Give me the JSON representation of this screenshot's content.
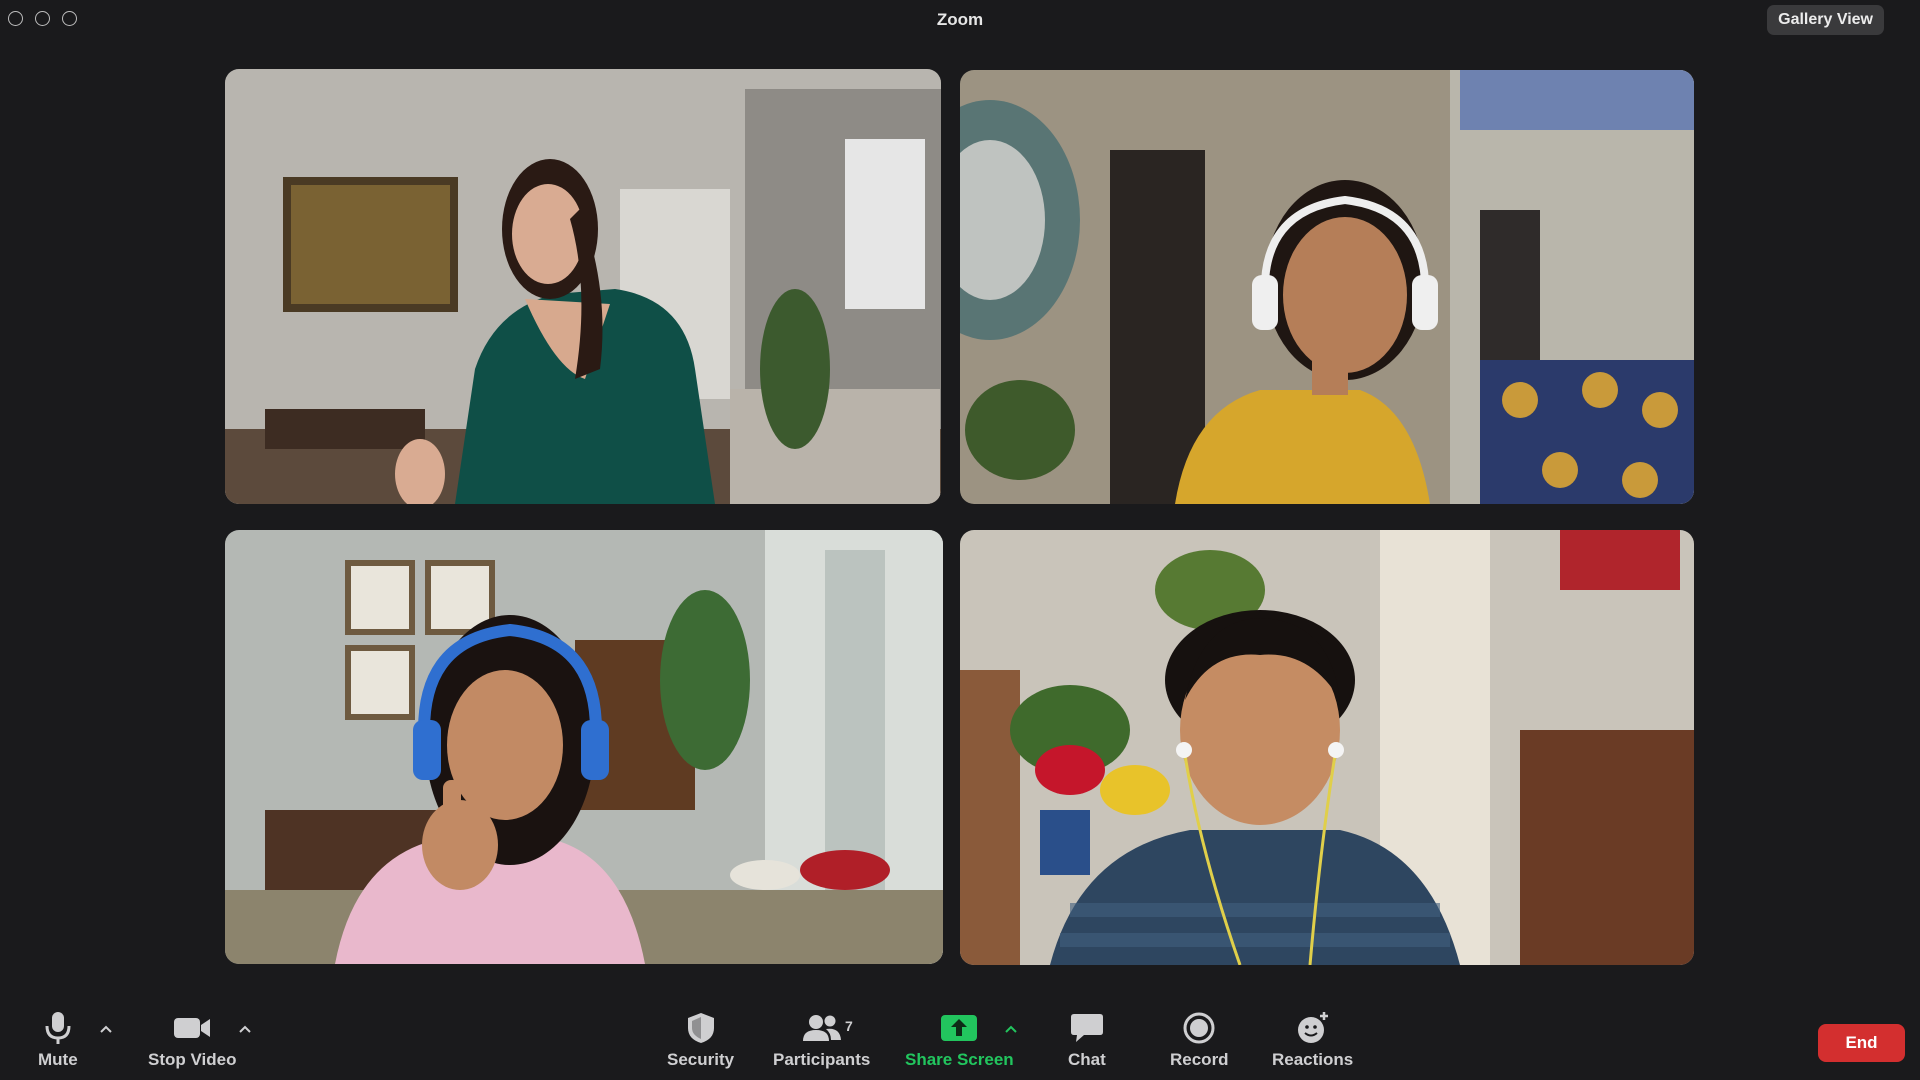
{
  "window": {
    "title": "Zoom"
  },
  "view_toggle": {
    "label": "Gallery View"
  },
  "participants_tiles": [
    {
      "scene": "woman in green top gesturing in living room",
      "accent": "#0f4f47"
    },
    {
      "scene": "girl with white headphones in yellow top",
      "accent": "#d6a62c"
    },
    {
      "scene": "girl with blue headphones giving thumbs up",
      "accent": "#e9b8cc"
    },
    {
      "scene": "boy with earphones in blue hoodie smiling",
      "accent": "#2e4660"
    }
  ],
  "toolbar": {
    "mute_label": "Mute",
    "stop_video_label": "Stop Video",
    "security_label": "Security",
    "participants_label": "Participants",
    "participants_count": "7",
    "share_screen_label": "Share Screen",
    "chat_label": "Chat",
    "record_label": "Record",
    "reactions_label": "Reactions",
    "end_label": "End"
  },
  "colors": {
    "share_green": "#22c55e",
    "end_red": "#d32f2f",
    "background": "#1a1a1c"
  },
  "icons": [
    "microphone-icon",
    "video-camera-icon",
    "shield-icon",
    "people-icon",
    "share-arrow-icon",
    "chat-bubble-icon",
    "record-icon",
    "smiley-plus-icon",
    "chevron-up-icon"
  ]
}
